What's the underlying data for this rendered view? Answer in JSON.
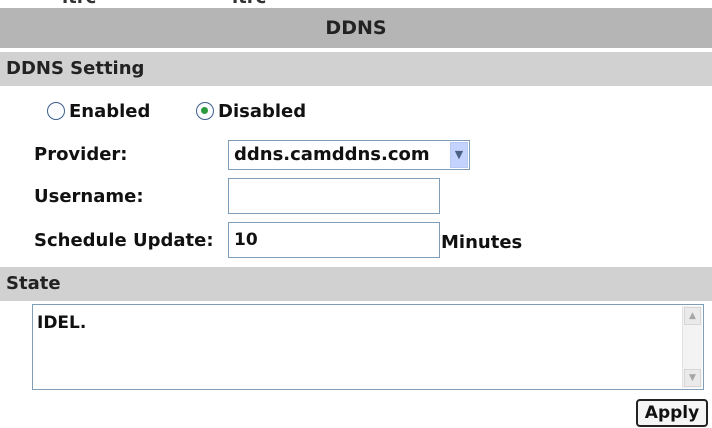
{
  "top_clipped_text": {
    "left": "ltrc",
    "right": "ltrc"
  },
  "title": "DDNS",
  "sections": {
    "setting": "DDNS Setting",
    "state": "State"
  },
  "mode": {
    "enabled_label": "Enabled",
    "disabled_label": "Disabled",
    "selected": "Disabled"
  },
  "fields": {
    "provider_label": "Provider:",
    "provider_value": "ddns.camddns.com",
    "username_label": "Username:",
    "username_value": "",
    "schedule_label": "Schedule Update:",
    "schedule_value": "10",
    "schedule_unit": "Minutes"
  },
  "state": {
    "text": "IDEL."
  },
  "buttons": {
    "apply": "Apply"
  },
  "icons": {
    "dropdown": "chevron-down-icon",
    "scroll_up": "scroll-up-icon",
    "scroll_down": "scroll-down-icon"
  },
  "colors": {
    "title_bar": "#b5b5b5",
    "section_bar": "#d1d1d1",
    "radio_dot": "#2b9a3c",
    "dropdown_button": "#c3d3fd"
  }
}
